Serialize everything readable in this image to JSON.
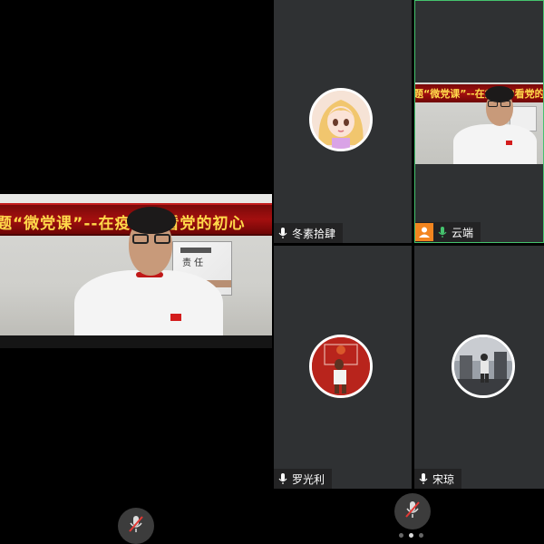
{
  "main_speaker": {
    "banner_text": "题“微党课”--在疫情中看党的初心",
    "slide_text": "责 任"
  },
  "tiles": [
    {
      "id": "tile-1",
      "name": "冬素拾肆",
      "mic": "on",
      "avatar": "cartoon-girl-avatar"
    },
    {
      "id": "tile-2",
      "name": "云端",
      "mic": "active",
      "host": true,
      "video": true,
      "banner_text": "题“微党课”--在疫情中看党的初心"
    },
    {
      "id": "tile-3",
      "name": "罗光利",
      "mic": "on",
      "avatar": "basketball-player-avatar"
    },
    {
      "id": "tile-4",
      "name": "宋琼",
      "mic": "on",
      "avatar": "person-photo-avatar"
    }
  ],
  "controls": {
    "mute_icon": "mic-muted-icon",
    "pages": 3,
    "current_page": 2
  },
  "colors": {
    "active_border": "#45c36e",
    "host_badge": "#f3851f",
    "banner_red": "#a30f0f",
    "banner_text": "#ffd84a",
    "mute_slash": "#e53935"
  }
}
